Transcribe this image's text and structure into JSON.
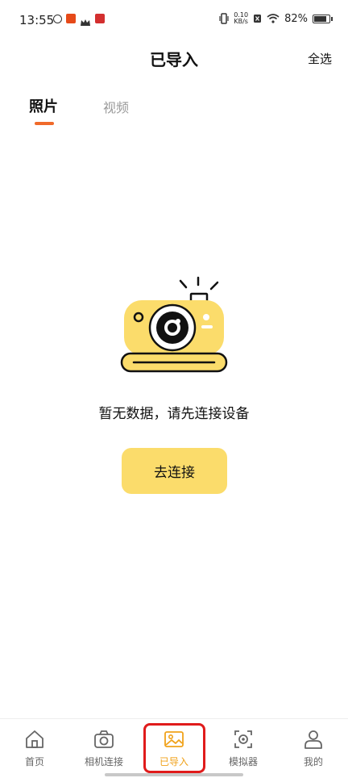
{
  "status_bar": {
    "time": "13:55",
    "net_speed_value": "0.10",
    "net_speed_unit": "KB/s",
    "battery": "82%",
    "battery_level": 0.82
  },
  "header": {
    "title": "已导入",
    "select_all": "全选"
  },
  "tabs": [
    {
      "label": "照片",
      "active": true
    },
    {
      "label": "视频",
      "active": false
    }
  ],
  "empty_state": {
    "message": "暂无数据，请先连接设备",
    "button_label": "去连接"
  },
  "bottom_nav": [
    {
      "label": "首页",
      "icon": "home-icon"
    },
    {
      "label": "相机连接",
      "icon": "camera-icon"
    },
    {
      "label": "已导入",
      "icon": "image-icon",
      "active": true
    },
    {
      "label": "模拟器",
      "icon": "simulator-icon"
    },
    {
      "label": "我的",
      "icon": "person-icon"
    }
  ],
  "colors": {
    "accent_orange": "#f06a2a",
    "button_yellow": "#fbdc6b",
    "active_nav": "#f0a21a",
    "highlight_red": "#e01b1b"
  }
}
